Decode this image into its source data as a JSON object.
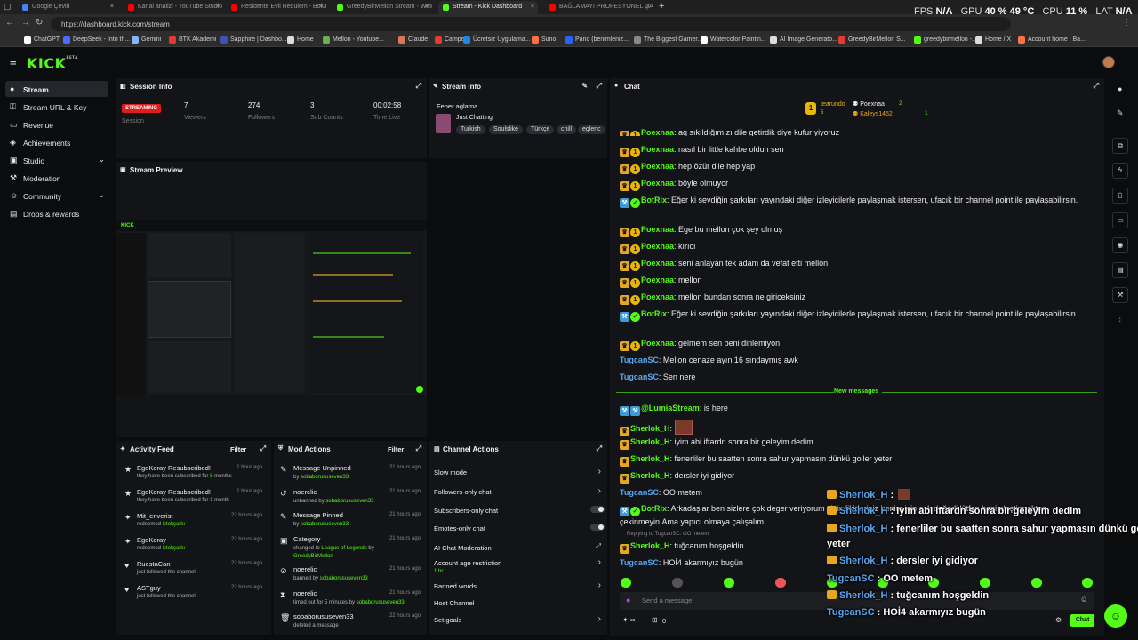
{
  "browser": {
    "tabs": [
      {
        "label": "Google Çeviri",
        "color": "#4285f4"
      },
      {
        "label": "Kanal analizi - YouTube Studio",
        "color": "#ff0000"
      },
      {
        "label": "Residente Evil Requiem - Bölüm 2",
        "color": "#ff0000"
      },
      {
        "label": "GreedyBirMellon Stream - Watch Li",
        "color": "#53fc18"
      },
      {
        "label": "Stream - Kick Dashboard",
        "color": "#53fc18"
      },
      {
        "label": "BAĞLAMAYI PROFESYONEL ÇALMA",
        "color": "#ff0000"
      }
    ],
    "url": "https://dashboard.kick.com/stream",
    "hud": {
      "fps_label": "FPS",
      "fps": "N/A",
      "gpu_label": "GPU",
      "gpu": "40 % 49 °C",
      "cpu_label": "CPU",
      "cpu": "11 %",
      "lat_label": "LAT",
      "lat": "N/A"
    },
    "bookmarks": [
      {
        "label": "ChatGPT",
        "color": "#ffffff"
      },
      {
        "label": "DeepSeek - Into th...",
        "color": "#4d6bfe"
      },
      {
        "label": "Gemini",
        "color": "#8ab4f8"
      },
      {
        "label": "BTK Akademi",
        "color": "#e53935"
      },
      {
        "label": "Sapphire | Dashbo...",
        "color": "#3f51b5"
      },
      {
        "label": "Home",
        "color": "#dddddd"
      },
      {
        "label": "Mellon - Youtube...",
        "color": "#6ab04c"
      },
      {
        "label": "Claude",
        "color": "#d97757"
      },
      {
        "label": "Camper",
        "color": "#e53935"
      },
      {
        "label": "Ücretsiz Uygulama...",
        "color": "#1e88e5"
      },
      {
        "label": "Suno",
        "color": "#ff7043"
      },
      {
        "label": "Pano (benimleniz...",
        "color": "#2962ff"
      },
      {
        "label": "The Biggest Gamer...",
        "color": "#888888"
      },
      {
        "label": "Watercolor Paintin...",
        "color": "#ffffff"
      },
      {
        "label": "AI Image Generato...",
        "color": "#dddddd"
      },
      {
        "label": "GreedyBirMellon S...",
        "color": "#e53935"
      },
      {
        "label": "greedybirmellon -...",
        "color": "#53fc18"
      },
      {
        "label": "Home / X",
        "color": "#dddddd"
      },
      {
        "label": "Account home | Ba...",
        "color": "#ff7043"
      }
    ]
  },
  "kick": {
    "logo": "KICK",
    "logo_sup": "BETA",
    "sidebar": [
      {
        "label": "Stream",
        "icon": "●",
        "active": true
      },
      {
        "label": "Stream URL & Key",
        "icon": "⚿"
      },
      {
        "label": "Revenue",
        "icon": "▭"
      },
      {
        "label": "Achievements",
        "icon": "◈"
      },
      {
        "label": "Studio",
        "icon": "▣",
        "chevron": true
      },
      {
        "label": "Moderation",
        "icon": "⚒"
      },
      {
        "label": "Community",
        "icon": "☺",
        "chevron": true
      },
      {
        "label": "Drops & rewards",
        "icon": "▤"
      }
    ],
    "session": {
      "title": "Session Info",
      "status": "STREAMING",
      "status_label": "Session",
      "viewers": "7",
      "viewers_label": "Viewers",
      "followers": "274",
      "followers_label": "Followers",
      "subs": "3",
      "subs_label": "Sub Counts",
      "time": "00:02:58",
      "time_label": "Time Live"
    },
    "stream_info": {
      "title": "Stream info",
      "stream_title": "Fener aglama",
      "category": "Just Chatting",
      "tags": [
        "Turkish",
        "Soulslike",
        "Türkçe",
        "chill",
        "eglenc"
      ]
    },
    "preview": {
      "title": "Stream Preview"
    },
    "activity": {
      "title": "Activity Feed",
      "filter": "Filter",
      "items": [
        {
          "icon": "★",
          "title": "EgeKoray Resubscribed!",
          "sub_pre": "they have been subscribed for ",
          "sub_hl": "8",
          "sub_post": " months",
          "time": "1 hour ago"
        },
        {
          "icon": "★",
          "title": "EgeKoray Resubscribed!",
          "sub_pre": "they have been subscribed for ",
          "sub_hl": "1",
          "sub_post": " month",
          "time": "1 hour ago"
        },
        {
          "icon": "✦",
          "title": "Mit_enverist",
          "sub_pre": "redeemed ",
          "sub_hl": "istekşarkı",
          "sub_post": "",
          "time": "22 hours ago"
        },
        {
          "icon": "✦",
          "title": "EgeKoray",
          "sub_pre": "redeemed ",
          "sub_hl": "istekşarkı",
          "sub_post": "",
          "time": "22 hours ago"
        },
        {
          "icon": "♥",
          "title": "RuestaCan",
          "sub_pre": "just followed the channel",
          "sub_hl": "",
          "sub_post": "",
          "time": "22 hours ago"
        },
        {
          "icon": "♥",
          "title": "ASTguy",
          "sub_pre": "just followed the channel",
          "sub_hl": "",
          "sub_post": "",
          "time": "22 hours ago"
        }
      ]
    },
    "mod": {
      "title": "Mod Actions",
      "filter": "Filter",
      "items": [
        {
          "icon": "✎",
          "title": "Message Unpinned",
          "pre": "by ",
          "hl": "sobaborususeven33",
          "post": "",
          "time": "21 hours ago"
        },
        {
          "icon": "↺",
          "title": "noerelic",
          "pre": "unbanned by ",
          "hl": "sobaborususeven33",
          "post": "",
          "time": "21 hours ago"
        },
        {
          "icon": "✎",
          "title": "Message Pinned",
          "pre": "by ",
          "hl": "sobaborususeven33",
          "post": "",
          "time": "21 hours ago"
        },
        {
          "icon": "▣",
          "title": "Category",
          "pre": "changed to ",
          "hl": "League of Legends",
          "post": " by ",
          "hl2": "GreedyBirMellon",
          "time": "21 hours ago"
        },
        {
          "icon": "⊘",
          "title": "noerelic",
          "pre": "banned by ",
          "hl": "sobaborususeven33",
          "post": "",
          "time": "21 hours ago"
        },
        {
          "icon": "⧗",
          "title": "noerelic",
          "pre": "timed out for 5 minutes by ",
          "hl": "sobaborususeven33",
          "post": "",
          "time": "21 hours ago"
        },
        {
          "icon": "🗑",
          "title": "sobaborususeven33",
          "pre": "deleted a message",
          "hl": "",
          "post": "",
          "time": "22 hours ago"
        }
      ]
    },
    "channel_actions": {
      "title": "Channel Actions",
      "items": [
        {
          "label": "Slow mode",
          "kind": "arrow"
        },
        {
          "label": "Followers-only chat",
          "kind": "arrow"
        },
        {
          "label": "Subscribers-only chat",
          "kind": "toggle"
        },
        {
          "label": "Emotes-only chat",
          "kind": "toggle"
        },
        {
          "label": "AI Chat Moderation",
          "kind": "ext"
        },
        {
          "label": "Account age restriction",
          "kind": "arrow",
          "sub": "1 hr"
        },
        {
          "label": "Banned words",
          "kind": "arrow"
        },
        {
          "label": "Host Channel",
          "kind": "none"
        },
        {
          "label": "Set goals",
          "kind": "arrow"
        }
      ]
    },
    "chat": {
      "title": "Chat",
      "leaderboard": {
        "top": "tearundo",
        "top_count": "5",
        "second": "Poexnaa",
        "second_count": "2",
        "third": "Kaleys1452",
        "third_count": "1"
      },
      "messages": [
        {
          "user": "Poexnaa",
          "color": "#53fc18",
          "badges": [
            "crown",
            "sub"
          ],
          "text": "aq sıkıldığımızı dile getirdik diye kufur yiyoruz"
        },
        {
          "user": "Poexnaa",
          "color": "#53fc18",
          "badges": [
            "crown",
            "sub"
          ],
          "text": "nasıl bir little kahbe oldun sen"
        },
        {
          "user": "Poexnaa",
          "color": "#53fc18",
          "badges": [
            "crown",
            "sub"
          ],
          "text": "hep özür dile hep yap"
        },
        {
          "user": "Poexnaa",
          "color": "#53fc18",
          "badges": [
            "crown",
            "sub"
          ],
          "text": "böyle olmuyor"
        },
        {
          "user": "BotRix",
          "color": "#53fc18",
          "badges": [
            "bot",
            "ver"
          ],
          "text": "Eğer ki sevdiğin şarkıları yayındaki diğer izleyicilerle paylaşmak istersen, ufacık bir channel point ile paylaşabilirsin."
        },
        {
          "user": "Poexnaa",
          "color": "#53fc18",
          "badges": [
            "crown",
            "sub"
          ],
          "text": "Ege bu mellon çok şey olmuş"
        },
        {
          "user": "Poexnaa",
          "color": "#53fc18",
          "badges": [
            "crown",
            "sub"
          ],
          "text": "kırıcı"
        },
        {
          "user": "Poexnaa",
          "color": "#53fc18",
          "badges": [
            "crown",
            "sub"
          ],
          "text": "seni anlayan tek adam da vefat etti mellon"
        },
        {
          "user": "Poexnaa",
          "color": "#53fc18",
          "badges": [
            "crown",
            "sub"
          ],
          "text": "mellon"
        },
        {
          "user": "Poexnaa",
          "color": "#53fc18",
          "badges": [
            "crown",
            "sub"
          ],
          "text": "mellon bundan sonra ne giriceksiniz"
        },
        {
          "user": "BotRix",
          "color": "#53fc18",
          "badges": [
            "bot",
            "ver"
          ],
          "text": "Eğer ki sevdiğin şarkıları yayındaki diğer izleyicilerle paylaşmak istersen, ufacık bir channel point ile paylaşabilirsin."
        },
        {
          "user": "Poexnaa",
          "color": "#53fc18",
          "badges": [
            "crown",
            "sub"
          ],
          "text": "gelmem sen beni dinlemiyon"
        },
        {
          "user": "TugcanSC",
          "color": "#5aa7f0",
          "badges": [],
          "text": "Mellon cenaze ayın 16 sındaymış awk"
        },
        {
          "user": "TugcanSC",
          "color": "#5aa7f0",
          "badges": [],
          "text": "Sen nere"
        }
      ],
      "new_messages": "New messages",
      "messages2": [
        {
          "user": "@LumiaStream",
          "color": "#53fc18",
          "badges": [
            "bot",
            "bot"
          ],
          "text": "is here"
        },
        {
          "user": "Sherlok_H",
          "color": "#53fc18",
          "badges": [
            "crown"
          ],
          "text": ""
        },
        {
          "user": "Sherlok_H",
          "color": "#53fc18",
          "badges": [
            "crown"
          ],
          "text": "iyim abi iftardn sonra bir geleyim dedim"
        },
        {
          "user": "Sherlok_H",
          "color": "#53fc18",
          "badges": [
            "crown"
          ],
          "text": "fenerliler bu saatten sonra sahur yapmasın dünkü goller yeter"
        },
        {
          "user": "Sherlok_H",
          "color": "#53fc18",
          "badges": [
            "crown"
          ],
          "text": "dersler iyi gidiyor"
        },
        {
          "user": "TugcanSC",
          "color": "#5aa7f0",
          "badges": [],
          "text": "OO metem"
        },
        {
          "user": "BotRix",
          "color": "#53fc18",
          "badges": [
            "bot",
            "ver"
          ],
          "text": "Arkadaşlar ben sizlere çok deger veriyorum sizin fikirleriniz benim için çok değerli lütfen beni eleştirmekten çekinmeyin.Ama yapıcı olmaya çalışalım."
        },
        {
          "user": "Sherlok_H",
          "color": "#53fc18",
          "badges": [
            "crown"
          ],
          "text": "tuğcanım hoşgeldin",
          "reply": "Replying to TugcanSC: OO metem"
        },
        {
          "user": "TugcanSC",
          "color": "#5aa7f0",
          "badges": [],
          "text": "HOİ4 akarmıyız bugün"
        }
      ],
      "input_placeholder": "Send a message",
      "chat_button": "Chat",
      "viewers_count": "0"
    },
    "overlay": [
      {
        "user": "Sherlok_H",
        "color": "#5aa7f0",
        "text": ""
      },
      {
        "user": "Sherlok_H",
        "color": "#5aa7f0",
        "text": "iyim abi iftardn sonra bir geleyim dedim"
      },
      {
        "user": "Sherlok_H",
        "color": "#5aa7f0",
        "text": "fenerliler bu saatten sonra sahur yapmasın dünkü goller"
      },
      {
        "user": "",
        "color": "#ffffff",
        "text": "yeter"
      },
      {
        "user": "Sherlok_H",
        "color": "#5aa7f0",
        "text": "dersler iyi gidiyor"
      },
      {
        "user": "TugcanSC",
        "color": "#5aa7f0",
        "text": "OO metem"
      },
      {
        "user": "Sherlok_H",
        "color": "#5aa7f0",
        "text": "tuğcanım hoşgeldin"
      },
      {
        "user": "TugcanSC",
        "color": "#5aa7f0",
        "text": "HOİ4 akarmıyız bugün"
      }
    ]
  }
}
